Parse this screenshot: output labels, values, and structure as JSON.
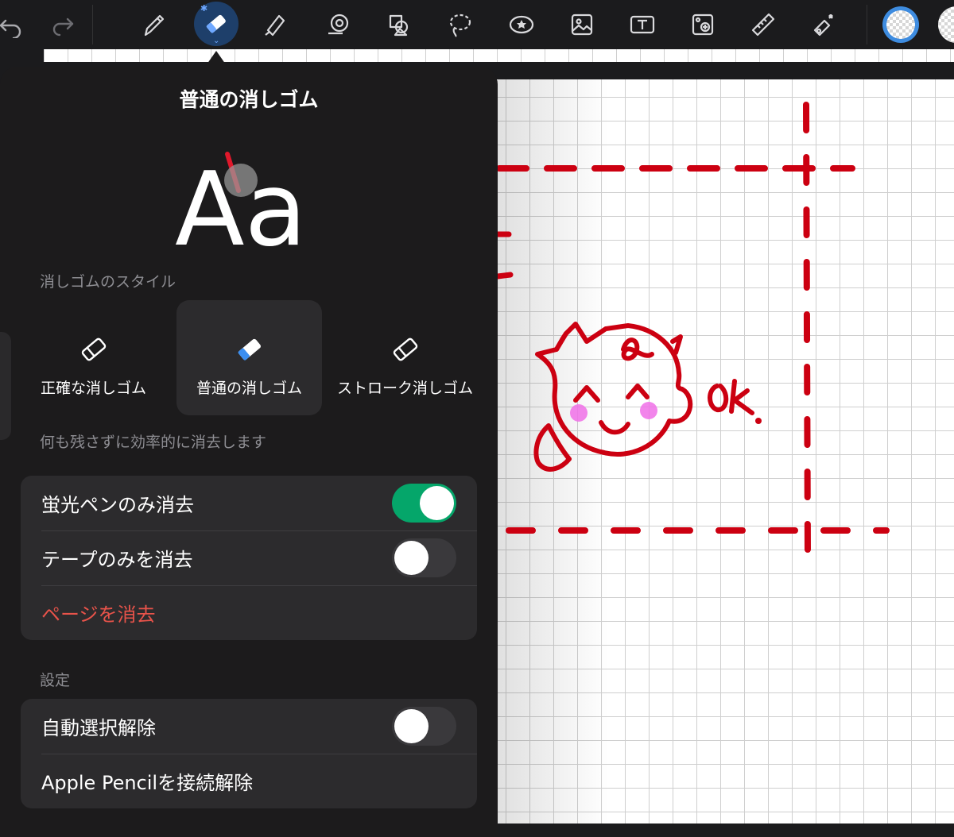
{
  "toolbar": {
    "tools": [
      {
        "icon": "undo-icon"
      },
      {
        "icon": "redo-icon"
      },
      {
        "icon": "pen-icon"
      },
      {
        "icon": "eraser-icon",
        "active": true
      },
      {
        "icon": "highlighter-icon"
      },
      {
        "icon": "tape-icon"
      },
      {
        "icon": "shapes-icon"
      },
      {
        "icon": "lasso-icon"
      },
      {
        "icon": "elements-icon"
      },
      {
        "icon": "image-icon"
      },
      {
        "icon": "text-icon"
      },
      {
        "icon": "camera-image-icon"
      },
      {
        "icon": "ruler-icon"
      },
      {
        "icon": "laser-pointer-icon"
      }
    ],
    "accent": "#6fa8ff"
  },
  "popover": {
    "title": "普通の消しゴム",
    "preview_text": "Aa",
    "style_section_label": "消しゴムのスタイル",
    "styles": [
      {
        "label": "正確な消しゴム",
        "selected": false
      },
      {
        "label": "普通の消しゴム",
        "selected": true
      },
      {
        "label": "ストローク消しゴム",
        "selected": false
      }
    ],
    "style_description": "何も残さずに効率的に消去します",
    "options": [
      {
        "label": "蛍光ペンのみ消去",
        "toggle": true
      },
      {
        "label": "テープのみを消去",
        "toggle": false
      },
      {
        "label": "ページを消去"
      }
    ],
    "settings_label": "設定",
    "settings": [
      {
        "label": "自動選択解除",
        "toggle": false
      },
      {
        "label": "Apple Pencilを接続解除"
      }
    ]
  },
  "canvas": {
    "drawing_color": "#cc0011",
    "cheek_color": "#f070e8",
    "annotation_text": "ok."
  },
  "colors": {
    "toggle_on": "#05a66a",
    "danger": "#e8534a",
    "selected_tool_bg": "#1e3f6a"
  }
}
